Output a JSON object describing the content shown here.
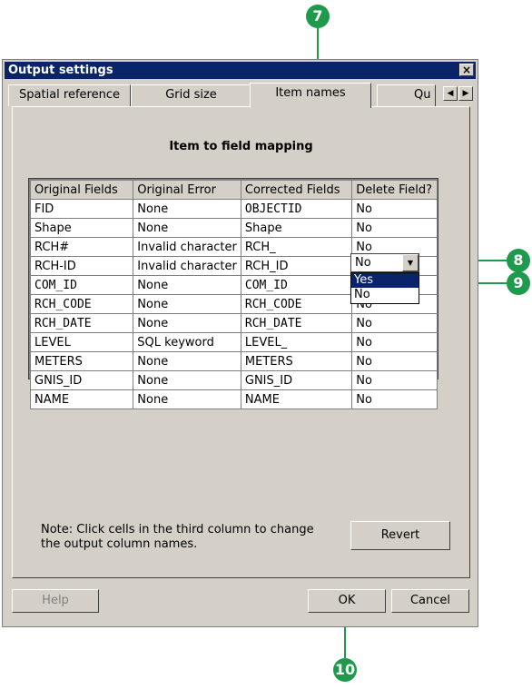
{
  "callouts": {
    "c7": "7",
    "c8": "8",
    "c9": "9",
    "c10": "10"
  },
  "window": {
    "title": "Output settings",
    "close_glyph": "×"
  },
  "tabs": [
    {
      "label": "Spatial reference"
    },
    {
      "label": "Grid size"
    },
    {
      "label": "Item names"
    },
    {
      "label": "Qu"
    }
  ],
  "tab_scroll": {
    "left": "◀",
    "right": "▶"
  },
  "section_heading": "Item to field mapping",
  "table": {
    "headers": [
      "Original Fields",
      "Original Error",
      "Corrected Fields",
      "Delete Field?"
    ],
    "rows": [
      [
        "FID",
        "None",
        "OBJECTID",
        "No"
      ],
      [
        "Shape",
        "None",
        "Shape",
        "No"
      ],
      [
        "RCH#",
        "Invalid character",
        "RCH_",
        "No"
      ],
      [
        "RCH-ID",
        "Invalid character",
        "RCH_ID",
        "No"
      ],
      [
        "COM_ID",
        "None",
        "COM_ID",
        "No"
      ],
      [
        "RCH_CODE",
        "None",
        "RCH_CODE",
        "No"
      ],
      [
        "RCH_DATE",
        "None",
        "RCH_DATE",
        "No"
      ],
      [
        "LEVEL",
        "SQL keyword",
        "LEVEL_",
        "No"
      ],
      [
        "METERS",
        "None",
        "METERS",
        "No"
      ],
      [
        "GNIS_ID",
        "None",
        "GNIS_ID",
        "No"
      ],
      [
        "NAME",
        "None",
        "NAME",
        "No"
      ]
    ]
  },
  "dropdown": {
    "value": "No",
    "arrow": "▼",
    "options": [
      "Yes",
      "No"
    ]
  },
  "note": "Note: Click cells in the third column to change the output column names.",
  "buttons": {
    "revert": "Revert",
    "help": "Help",
    "ok": "OK",
    "cancel": "Cancel"
  },
  "colors": {
    "callout": "#1f9a4c",
    "title_bar": "#0a246a",
    "face": "#d4d0c8"
  }
}
